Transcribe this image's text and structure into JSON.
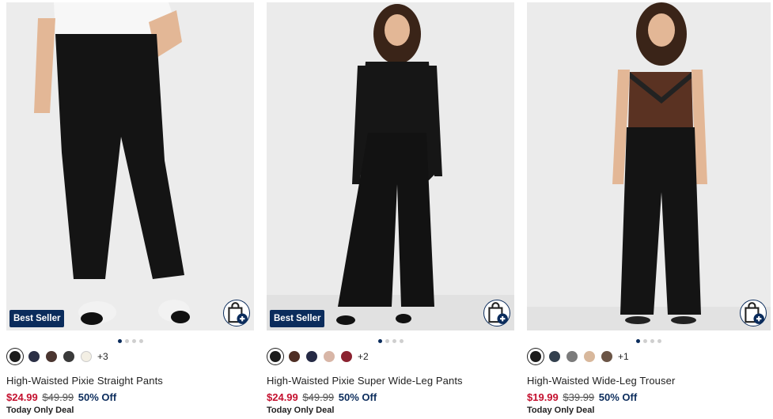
{
  "products": [
    {
      "name": "High-Waisted Pixie Straight Pants",
      "sale_price": "$24.99",
      "original_price": "$49.99",
      "discount": "50% Off",
      "deal": "Today Only Deal",
      "badge": "Best Seller",
      "more_colors": "+3",
      "swatches": [
        "#1b1b1b",
        "#2b2f45",
        "#4a3530",
        "#3a3a3a",
        "#f3efe4"
      ],
      "carousel_dots": 4,
      "carousel_active": 0
    },
    {
      "name": "High-Waisted Pixie Super Wide-Leg Pants",
      "sale_price": "$24.99",
      "original_price": "$49.99",
      "discount": "50% Off",
      "deal": "Today Only Deal",
      "badge": "Best Seller",
      "more_colors": "+2",
      "swatches": [
        "#1b1b1b",
        "#4e2e24",
        "#252a45",
        "#d8b6a7",
        "#8b2230"
      ],
      "carousel_dots": 4,
      "carousel_active": 0
    },
    {
      "name": "High-Waisted Wide-Leg Trouser",
      "sale_price": "$19.99",
      "original_price": "$39.99",
      "discount": "50% Off",
      "deal": "Today Only Deal",
      "badge": "",
      "more_colors": "+1",
      "swatches": [
        "#1b1b1b",
        "#33404e",
        "#7b7b7b",
        "#d8b89c",
        "#6b5546"
      ],
      "carousel_dots": 4,
      "carousel_active": 0
    }
  ],
  "icons": {
    "add_to_bag": "shopping-bag-plus-icon"
  },
  "colors": {
    "brand_navy": "#0b2c5c",
    "sale_red": "#c4102e"
  }
}
